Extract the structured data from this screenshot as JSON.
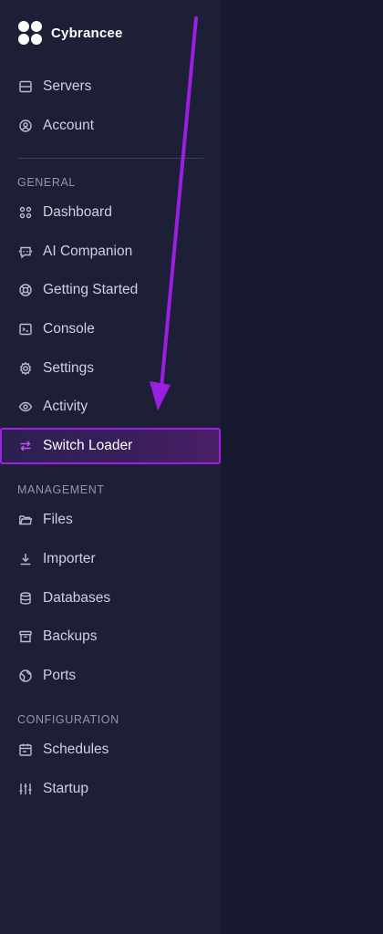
{
  "brand": {
    "name": "Cybrancee"
  },
  "top_nav": [
    {
      "label": "Servers",
      "icon": "server-icon"
    },
    {
      "label": "Account",
      "icon": "user-circle-icon"
    }
  ],
  "sections": {
    "general": "GENERAL",
    "management": "MANAGEMENT",
    "configuration": "CONFIGURATION"
  },
  "general_nav": [
    {
      "label": "Dashboard",
      "icon": "grid-icon"
    },
    {
      "label": "AI Companion",
      "icon": "bot-icon"
    },
    {
      "label": "Getting Started",
      "icon": "lifebuoy-icon"
    },
    {
      "label": "Console",
      "icon": "terminal-icon"
    },
    {
      "label": "Settings",
      "icon": "gear-icon"
    },
    {
      "label": "Activity",
      "icon": "eye-icon"
    },
    {
      "label": "Switch Loader",
      "icon": "switch-arrows-icon",
      "active": true
    }
  ],
  "management_nav": [
    {
      "label": "Files",
      "icon": "folder-icon"
    },
    {
      "label": "Importer",
      "icon": "download-icon"
    },
    {
      "label": "Databases",
      "icon": "database-icon"
    },
    {
      "label": "Backups",
      "icon": "archive-icon"
    },
    {
      "label": "Ports",
      "icon": "globe-icon"
    }
  ],
  "configuration_nav": [
    {
      "label": "Schedules",
      "icon": "calendar-icon"
    },
    {
      "label": "Startup",
      "icon": "sliders-icon"
    }
  ],
  "colors": {
    "sidebar_bg": "#1c1f35",
    "main_bg": "#171a2e",
    "accent": "#a21ee6",
    "annotation_arrow": "#9b1fe0"
  }
}
